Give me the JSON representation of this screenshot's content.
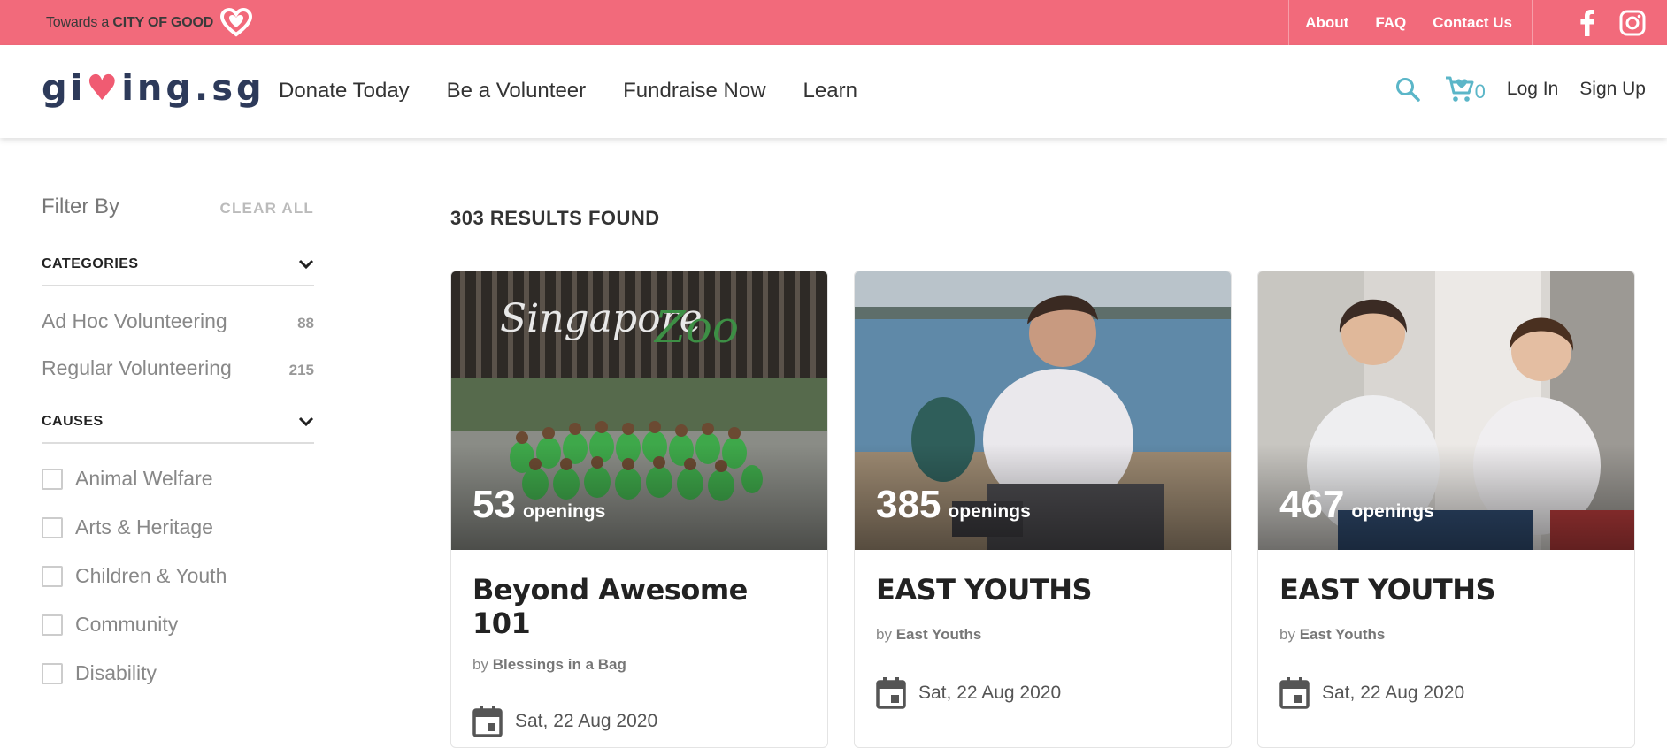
{
  "topbar": {
    "tagline_prefix": "Towards a",
    "tagline_strong": "CITY OF GOOD",
    "links": [
      "About",
      "FAQ",
      "Contact Us"
    ],
    "socials": [
      "facebook-icon",
      "instagram-icon"
    ]
  },
  "header": {
    "brand_part1": "gi",
    "brand_part2": "ing.sg",
    "nav": [
      "Donate Today",
      "Be a Volunteer",
      "Fundraise Now",
      "Learn"
    ],
    "cart_count": "0",
    "login_label": "Log In",
    "signup_label": "Sign Up"
  },
  "sidebar": {
    "filter_title": "Filter By",
    "clear_all": "CLEAR ALL",
    "categories_title": "CATEGORIES",
    "categories": [
      {
        "label": "Ad Hoc Volunteering",
        "count": "88"
      },
      {
        "label": "Regular Volunteering",
        "count": "215"
      }
    ],
    "causes_title": "CAUSES",
    "causes": [
      "Animal Welfare",
      "Arts & Heritage",
      "Children & Youth",
      "Community",
      "Disability"
    ]
  },
  "results": {
    "title": "303 RESULTS FOUND",
    "cards": [
      {
        "openings": "53",
        "openings_word": "openings",
        "title": "Beyond Awesome 101",
        "by_prefix": "by",
        "org": "Blessings in a Bag",
        "date": "Sat, 22 Aug 2020"
      },
      {
        "openings": "385",
        "openings_word": "openings",
        "title": "EAST YOUTHS",
        "by_prefix": "by",
        "org": "East Youths",
        "date": "Sat, 22 Aug 2020"
      },
      {
        "openings": "467",
        "openings_word": "openings",
        "title": "EAST YOUTHS",
        "by_prefix": "by",
        "org": "East Youths",
        "date": "Sat, 22 Aug 2020"
      }
    ]
  },
  "colors": {
    "topbar": "#f26a7b",
    "brand_navy": "#2d3a5a",
    "heart_pink": "#f05b72",
    "accent_teal": "#5bb6c8"
  }
}
